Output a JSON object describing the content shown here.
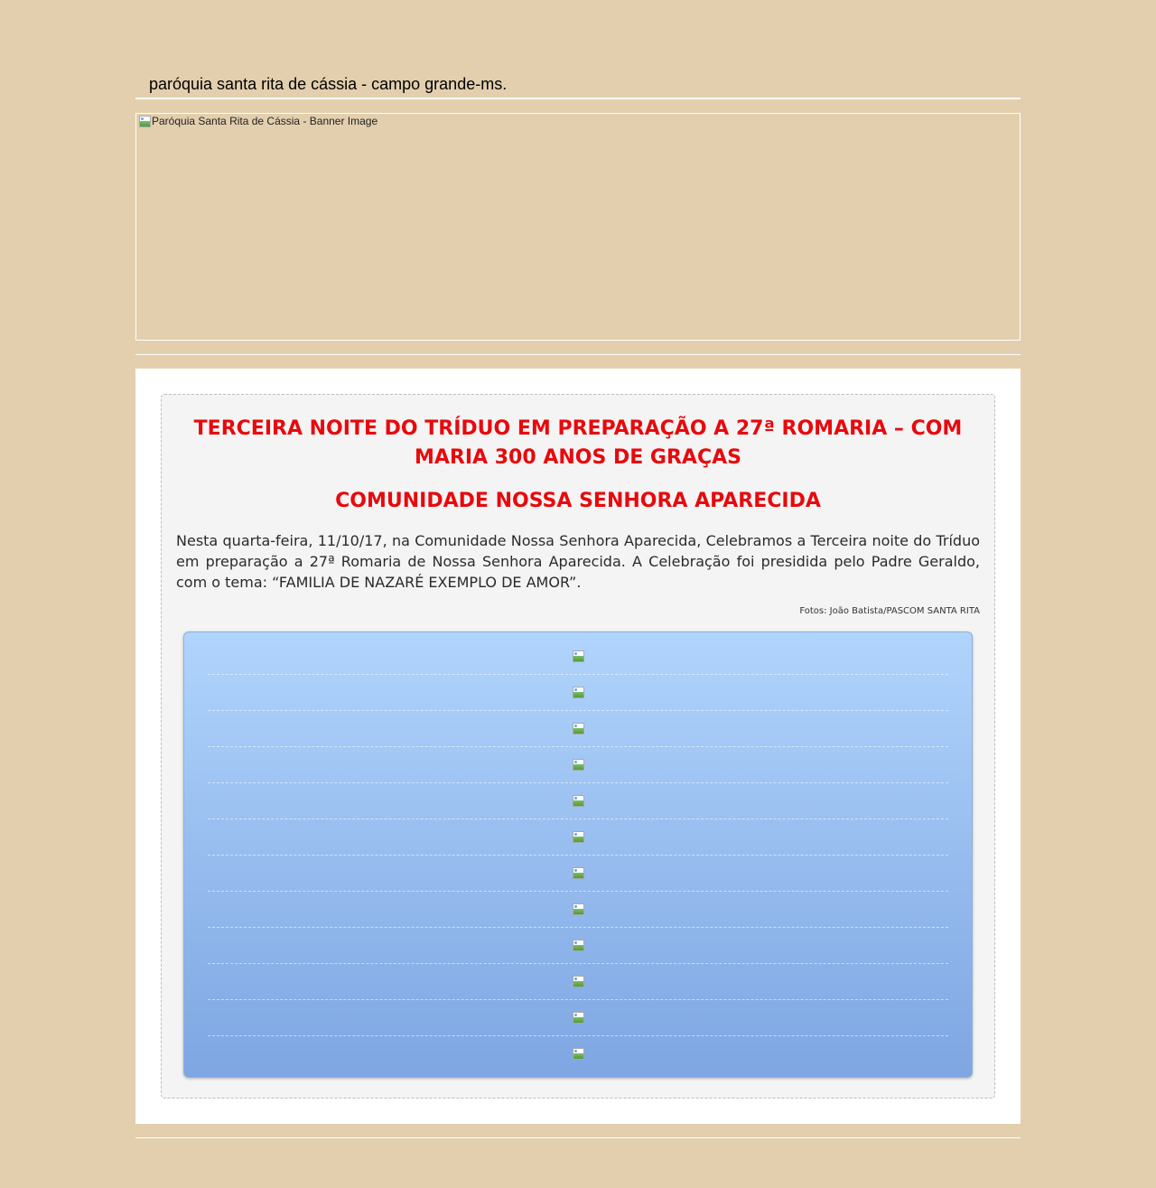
{
  "site": {
    "title": "paróquia santa rita de cássia - campo grande-ms."
  },
  "banner": {
    "alt_text": "Paróquia Santa Rita de Cássia - Banner Image"
  },
  "post": {
    "title": "TERCEIRA NOITE DO TRÍDUO EM PREPARAÇÃO A 27ª ROMARIA – COM MARIA 300 ANOS DE GRAÇAS",
    "subtitle": "COMUNIDADE NOSSA SENHORA APARECIDA",
    "body": "Nesta quarta-feira, 11/10/17, na Comunidade Nossa Senhora Aparecida, Celebramos a Terceira noite do Tríduo em preparação a 27ª Romaria de Nossa Senhora Aparecida. A Celebração foi presidida pelo Padre Geraldo, com o tema: “FAMILIA DE NAZARÉ EXEMPLO DE AMOR”.",
    "photo_credit": "Fotos: João Batista/PASCOM SANTA RITA"
  },
  "gallery": {
    "image_count": 12
  },
  "colors": {
    "page_background": "#e3cfae",
    "title_red": "#e8090d",
    "gallery_top": "#b0d4fc",
    "gallery_bottom": "#7ea6e2"
  }
}
